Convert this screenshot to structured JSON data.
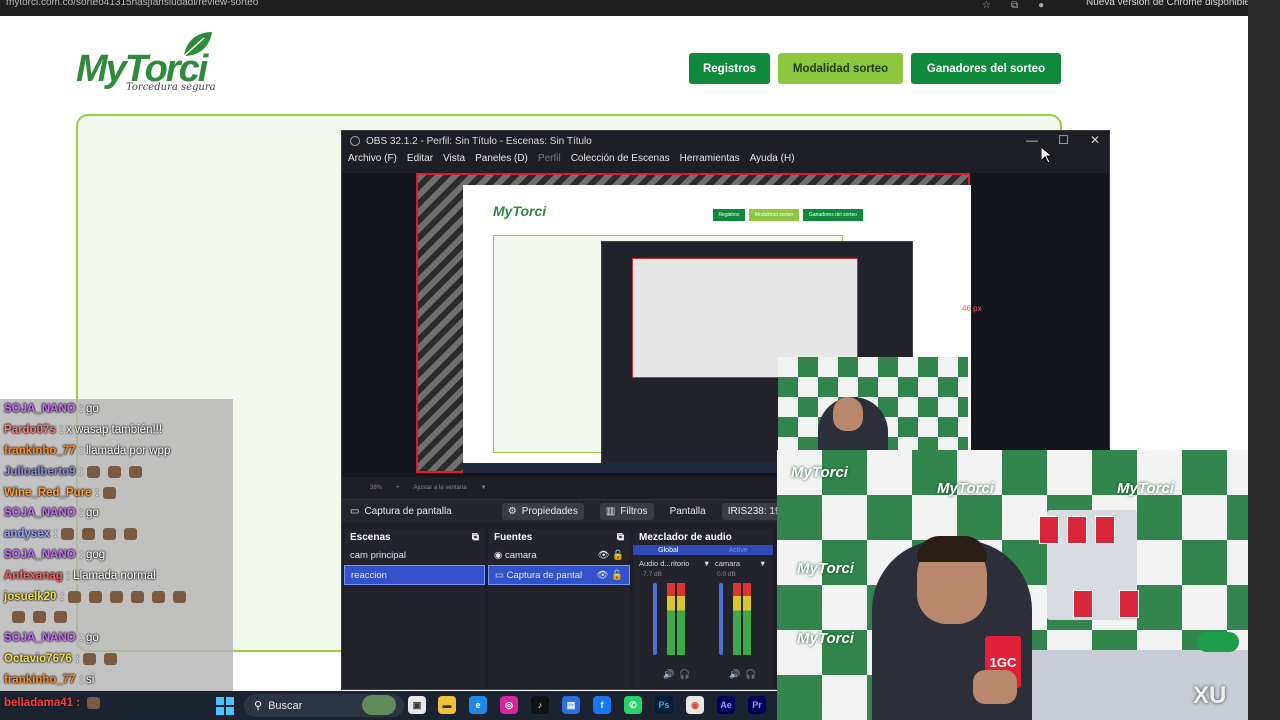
{
  "browser": {
    "url": "mytorci.com.co/sorteo41315hasjfahsiudadi/review-sorteo",
    "update_notice": "Nueva versión de Chrome disponible"
  },
  "site": {
    "logo_text": "MyTorci",
    "logo_tagline": "Torcedura segura",
    "nav": [
      "Registros",
      "Modalidad sorteo",
      "Ganadores del sorteo"
    ]
  },
  "chat": {
    "messages": [
      {
        "user": "SOJA_NANO",
        "text": ": go",
        "color": "#c86bff"
      },
      {
        "user": "Pardo07s",
        "text": ": x wasap también!!!",
        "color": "#ff7a7a"
      },
      {
        "user": "frankinho_77",
        "text": ": llamada por wpp",
        "color": "#ff8a1f"
      },
      {
        "user": "Julioalberto9",
        "text": ":",
        "color": "#8a8ad8",
        "emotes": 3
      },
      {
        "user": "Wine_Red_Pure",
        "text": ":",
        "color": "#ff9f3a",
        "emotes": 1
      },
      {
        "user": "SOJA_NANO",
        "text": ": go",
        "color": "#c86bff"
      },
      {
        "user": "andysex",
        "text": ":",
        "color": "#9aa0ff",
        "emotes": 4
      },
      {
        "user": "SOJA_NANO",
        "text": ": gog",
        "color": "#c86bff"
      },
      {
        "user": "Anfexanag",
        "text": ": Llamada normal",
        "color": "#ff5c5c"
      },
      {
        "user": "josuelk20",
        "text": ":",
        "color": "#f2e14a",
        "emotes": 6
      },
      {
        "user": "",
        "text": "",
        "color": "#ffffff",
        "emotes": 3
      },
      {
        "user": "SOJA_NANO",
        "text": ": go",
        "color": "#c86bff"
      },
      {
        "user": "Octavio7676",
        "text": ":",
        "color": "#f2e14a",
        "emotes": 2
      },
      {
        "user": "frankinho_77",
        "text": ": si",
        "color": "#ff8a1f"
      }
    ]
  },
  "obs": {
    "title": "OBS 32.1.2 - Perfil: Sin Título - Escenas: Sin Título",
    "menu": [
      "Archivo (F)",
      "Editar",
      "Vista",
      "Paneles (D)",
      "Perfil",
      "Colección de Escenas",
      "Herramientas",
      "Ayuda (H)"
    ],
    "preview_label": "46 px",
    "zoom_text": "38%",
    "fit_text": "Ajustar a la ventana",
    "source_bar": {
      "source": "Captura de pantalla",
      "properties": "Propiedades",
      "filters": "Filtros",
      "screen_label": "Pantalla",
      "screen_value": "IRIS238: 1920x1080"
    },
    "scenes": {
      "title": "Escenas",
      "items": [
        "cam principal",
        "reaccion"
      ],
      "selected": 1
    },
    "sources": {
      "title": "Fuentes",
      "items": [
        "camara",
        "Captura de pantal"
      ],
      "selected": 1
    },
    "mixer": {
      "title": "Mezclador de audio",
      "tabs": [
        "Global",
        "Active"
      ],
      "channels": [
        {
          "name": "Audio d...ritorio",
          "db": "-7.7 dB"
        },
        {
          "name": "camara",
          "db": "0.0 dB"
        }
      ]
    }
  },
  "webcam": {
    "brand": "MyTorci",
    "can_label": "1GC",
    "corner_text": "XU"
  },
  "taskbar": {
    "chat_user": "belladama41",
    "chat_sep": ":",
    "search_text": "Buscar"
  }
}
